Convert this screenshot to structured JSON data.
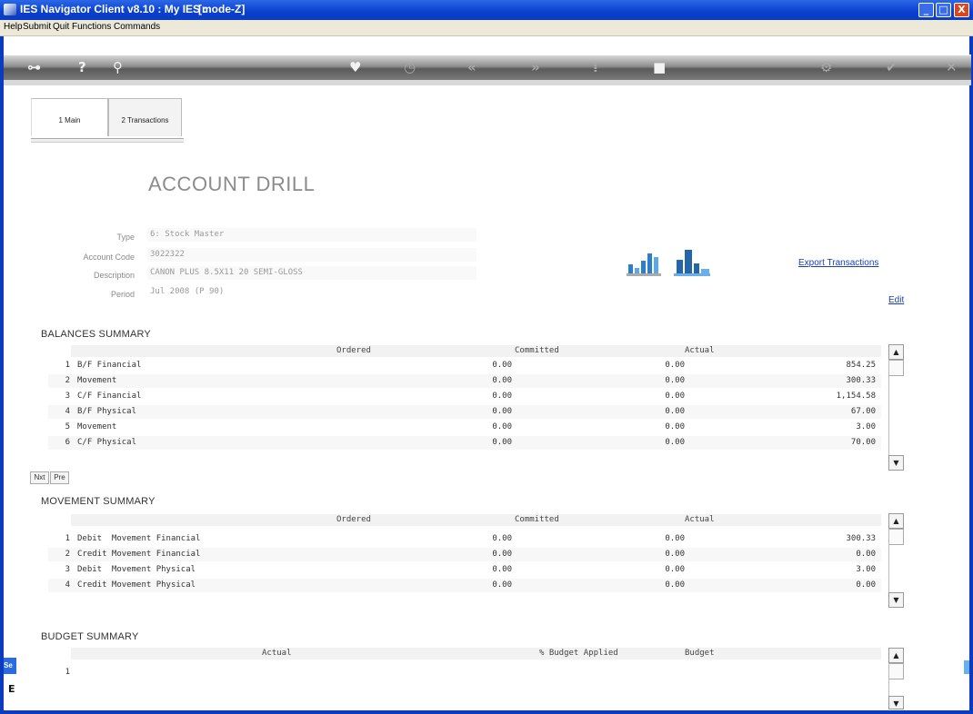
{
  "window": {
    "title": "IES Navigator Client v8.10 : My IES :",
    "mode": "[mode-Z]",
    "controls": {
      "minimize": "_",
      "maximize": "□",
      "close": "X"
    }
  },
  "menu": [
    "Help",
    "Submit",
    "Quit",
    "Functions",
    "Commands"
  ],
  "toolbar": {
    "icons": [
      "key-icon",
      "help-icon",
      "search-icon",
      "heart-icon",
      "clock-icon",
      "rewind-icon",
      "fast-forward-icon",
      "filter-icon",
      "stop-icon",
      "settings-icon",
      "check-icon",
      "close-icon"
    ]
  },
  "tabs": [
    "1 Main",
    "2 Transactions"
  ],
  "page_title": "ACCOUNT DRILL",
  "fields": {
    "type_label": "Type",
    "type_value": "6: Stock Master",
    "account_label": "Account Code",
    "account_value": "3022322",
    "description_label": "Description",
    "description_value": "CANON PLUS 8.5X11 20 SEMI-GLOSS",
    "period_label": "Period",
    "period_value": "Jul 2008 (P 90)"
  },
  "links": {
    "export": "Export Transactions",
    "edit": "Edit"
  },
  "balances": {
    "title": "BALANCES SUMMARY",
    "columns": [
      "Ordered",
      "Committed",
      "Actual"
    ],
    "rows": [
      {
        "n": "1",
        "d": "B/F Financial",
        "c1": "0.00",
        "c2": "0.00",
        "c3": "854.25"
      },
      {
        "n": "2",
        "d": "Movement",
        "c1": "0.00",
        "c2": "0.00",
        "c3": "300.33"
      },
      {
        "n": "3",
        "d": "C/F Financial",
        "c1": "0.00",
        "c2": "0.00",
        "c3": "1,154.58"
      },
      {
        "n": "4",
        "d": "B/F Physical",
        "c1": "0.00",
        "c2": "0.00",
        "c3": "67.00"
      },
      {
        "n": "5",
        "d": "Movement",
        "c1": "0.00",
        "c2": "0.00",
        "c3": "3.00"
      },
      {
        "n": "6",
        "d": "C/F Physical",
        "c1": "0.00",
        "c2": "0.00",
        "c3": "70.00"
      }
    ],
    "buttons": [
      "Nxt",
      "Pre"
    ]
  },
  "movement": {
    "title": "MOVEMENT SUMMARY",
    "columns": [
      "Ordered",
      "Committed",
      "Actual"
    ],
    "rows": [
      {
        "n": "1",
        "d": "Debit  Movement Financial",
        "c1": "0.00",
        "c2": "0.00",
        "c3": "300.33"
      },
      {
        "n": "2",
        "d": "Credit Movement Financial",
        "c1": "0.00",
        "c2": "0.00",
        "c3": "0.00"
      },
      {
        "n": "3",
        "d": "Debit  Movement Physical",
        "c1": "0.00",
        "c2": "0.00",
        "c3": "3.00"
      },
      {
        "n": "4",
        "d": "Credit Movement Physical",
        "c1": "0.00",
        "c2": "0.00",
        "c3": "0.00"
      }
    ]
  },
  "budget": {
    "title": "BUDGET SUMMARY",
    "columns": [
      "Actual",
      "% Budget Applied",
      "Budget"
    ],
    "rows": [
      {
        "n": "1",
        "d": "",
        "c1": "",
        "c2": "",
        "c3": ""
      }
    ]
  },
  "side": {
    "tab": "Se",
    "letter": "E"
  },
  "colors": {
    "titlebar": "#0a3fcf",
    "link": "#1a3fb8",
    "chart_blue": "#2a7fc9"
  }
}
